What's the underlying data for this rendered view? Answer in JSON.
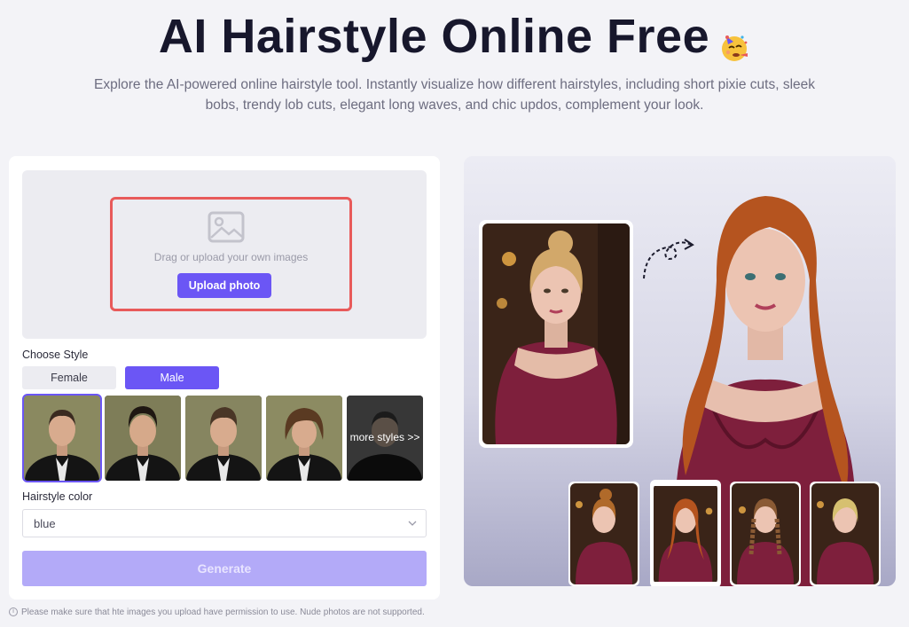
{
  "header": {
    "title": "AI Hairstyle Online Free",
    "title_emoji": "party-face-emoji",
    "subtitle": "Explore the AI-powered online hairstyle tool. Instantly visualize how different hairstyles, including short pixie cuts, sleek bobs, trendy lob cuts, elegant long waves, and chic updos, complement your look."
  },
  "upload": {
    "hint": "Drag or upload your own images",
    "button_label": "Upload photo",
    "icon": "image-icon"
  },
  "style": {
    "label": "Choose Style",
    "tabs": [
      {
        "label": "Female",
        "selected": false
      },
      {
        "label": "Male",
        "selected": true
      }
    ],
    "thumbnails": [
      {
        "name": "short-crop",
        "selected": true
      },
      {
        "name": "slick-back",
        "selected": false
      },
      {
        "name": "textured-quiff",
        "selected": false
      },
      {
        "name": "curly-medium",
        "selected": false
      }
    ],
    "more_label": "more styles >>"
  },
  "color": {
    "label": "Hairstyle color",
    "value": "blue"
  },
  "generate_label": "Generate",
  "notice": "Please make sure that hte images you upload have permission to use. Nude photos are not supported.",
  "colors": {
    "accent": "#6b56f5",
    "generate_disabled": "#b3aaf8",
    "highlight_border": "#e85a5a",
    "dress": "#7e1f3c",
    "red_hair": "#b5541f",
    "blonde_hair": "#d2a86a"
  }
}
